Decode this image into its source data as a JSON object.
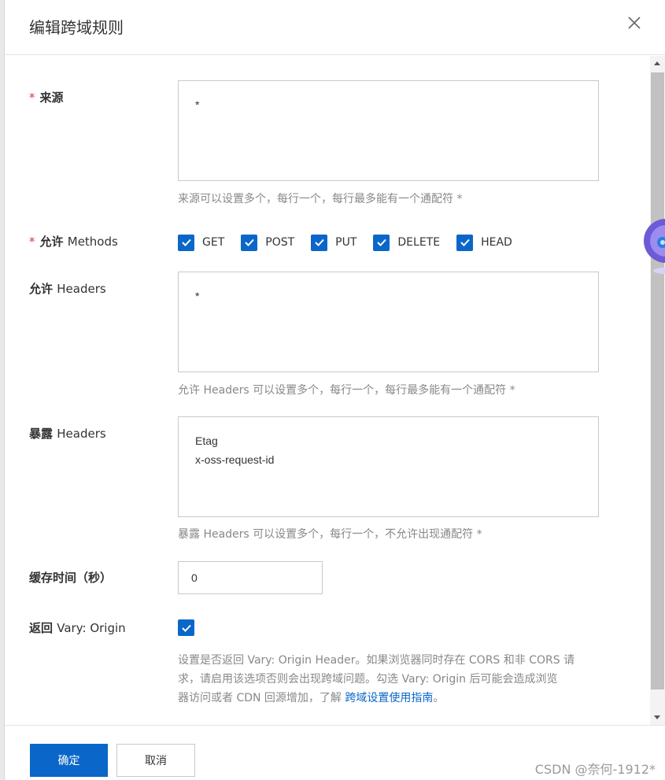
{
  "dialog": {
    "title": "编辑跨域规则",
    "close_icon": "close-icon"
  },
  "form": {
    "origin": {
      "required_mark": "*",
      "label": "来源",
      "value": "*",
      "hint": "来源可以设置多个，每行一个，每行最多能有一个通配符 *"
    },
    "methods": {
      "required_mark": "*",
      "label_cn": "允许",
      "label_en": "Methods",
      "options": [
        {
          "label": "GET",
          "checked": true
        },
        {
          "label": "POST",
          "checked": true
        },
        {
          "label": "PUT",
          "checked": true
        },
        {
          "label": "DELETE",
          "checked": true
        },
        {
          "label": "HEAD",
          "checked": true
        }
      ]
    },
    "allow_headers": {
      "label_cn": "允许",
      "label_en": "Headers",
      "value": "*",
      "hint": "允许 Headers 可以设置多个，每行一个，每行最多能有一个通配符 *"
    },
    "expose_headers": {
      "label_cn": "暴露",
      "label_en": "Headers",
      "value": "Etag\nx-oss-request-id",
      "hint": "暴露 Headers 可以设置多个，每行一个，不允许出现通配符 *"
    },
    "cache_time": {
      "label": "缓存时间（秒）",
      "value": "0"
    },
    "vary_origin": {
      "label_cn": "返回",
      "label_en": "Vary: Origin",
      "checked": true,
      "hint_line1": "设置是否返回 Vary: Origin Header。如果浏览器同时存在 CORS 和非 CORS 请",
      "hint_line2": "求，请启用该选项否则会出现跨域问题。勾选 Vary: Origin 后可能会造成浏览",
      "hint_line3_prefix": "器访问或者 CDN 回源增加，了解 ",
      "hint_link": "跨域设置使用指南",
      "hint_line3_suffix": "。"
    }
  },
  "footer": {
    "confirm_label": "确定",
    "cancel_label": "取消",
    "watermark": "CSDN @奈何-1912*"
  },
  "colors": {
    "primary": "#0a67c9",
    "required": "#e0332f",
    "hint": "#888888"
  }
}
